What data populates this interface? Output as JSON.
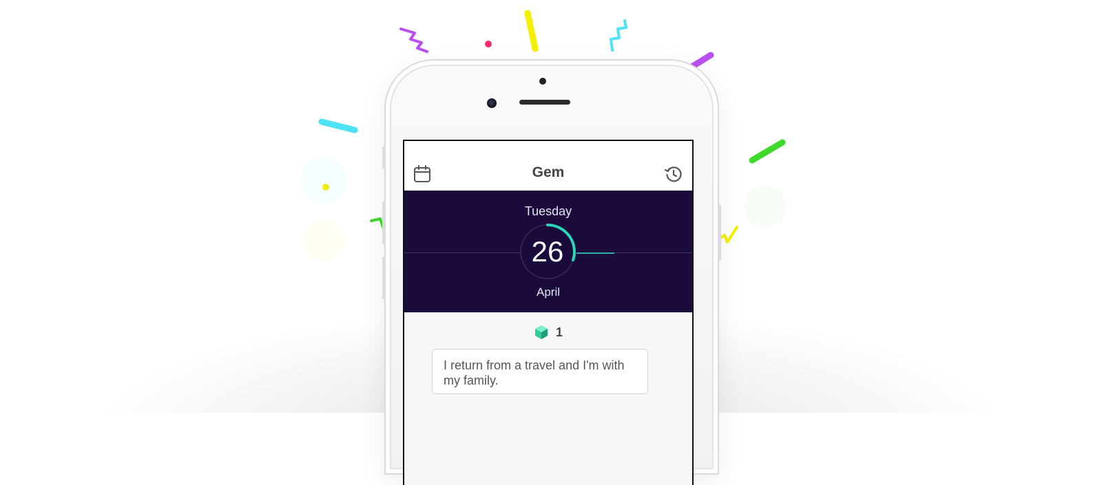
{
  "nav": {
    "title": "Gem",
    "left_icon": "calendar-icon",
    "right_icon": "history-icon"
  },
  "date": {
    "weekday": "Tuesday",
    "day": "26",
    "month": "April",
    "progress_fraction": 0.3
  },
  "gems": {
    "icon": "gem-icon",
    "count": "1"
  },
  "entry": {
    "text": "I return from a travel and I'm with my family."
  },
  "colors": {
    "hero_bg": "#1b0b3d",
    "accent": "#2ad6b4",
    "gem": "#2ecc9a"
  }
}
